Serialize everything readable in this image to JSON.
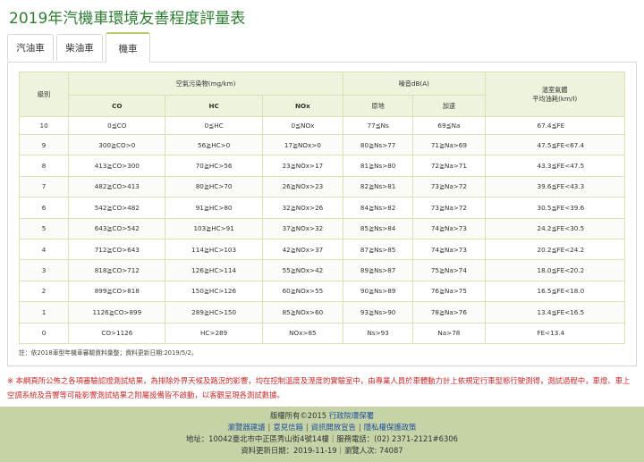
{
  "page": {
    "title": "2019年汽機車環境友善程度評量表"
  },
  "tabs": [
    "汽油車",
    "柴油車",
    "機車"
  ],
  "table": {
    "header": {
      "grade": "級別",
      "air": "空氣污染物(mg/km)",
      "noise": "噪音dB(A)",
      "fuel_line1": "溫室氣體",
      "fuel_line2": "平均油耗(km/l)",
      "co": "CO",
      "hc": "HC",
      "nox": "NOx",
      "stationary": "原地",
      "accel": "加速"
    },
    "rows": [
      [
        "10",
        "0≦CO",
        "0≦HC",
        "0≦NOx",
        "77≦Ns",
        "69≦Na",
        "67.4≦FE"
      ],
      [
        "9",
        "300≧CO>0",
        "56≧HC>0",
        "17≧NOx>0",
        "80≧Ns>77",
        "71≧Na>69",
        "47.5≦FE<67.4"
      ],
      [
        "8",
        "413≧CO>300",
        "70≧HC>56",
        "23≧NOx>17",
        "81≧Ns>80",
        "72≧Na>71",
        "43.3≦FE<47.5"
      ],
      [
        "7",
        "482≧CO>413",
        "80≧HC>70",
        "26≧NOx>23",
        "82≧Ns>81",
        "73≧Na>72",
        "39.6≦FE<43.3"
      ],
      [
        "6",
        "542≧CO>482",
        "91≧HC>80",
        "32≧NOx>26",
        "84≧Ns>82",
        "73≧Na>72",
        "30.5≦FE<39.6"
      ],
      [
        "5",
        "643≧CO>542",
        "103≧HC>91",
        "37≧NOx>32",
        "85≧Ns>84",
        "74≧Na>73",
        "24.2≦FE<30.5"
      ],
      [
        "4",
        "712≧CO>643",
        "114≧HC>103",
        "42≧NOx>37",
        "87≧Ns>85",
        "74≧Na>73",
        "20.2≦FE<24.2"
      ],
      [
        "3",
        "818≧CO>712",
        "126≧HC>114",
        "55≧NOx>42",
        "89≧Ns>87",
        "75≧Na>74",
        "18.0≦FE<20.2"
      ],
      [
        "2",
        "899≧CO>818",
        "150≧HC>126",
        "60≧NOx>55",
        "90≧Ns>89",
        "76≧Na>75",
        "16.5≦FE<18.0"
      ],
      [
        "1",
        "1126≧CO>899",
        "289≧HC>150",
        "85≧NOx>60",
        "93≧Ns>90",
        "78≧Na>76",
        "13.4≦FE<16.5"
      ],
      [
        "0",
        "CO>1126",
        "HC>289",
        "NOx>85",
        "Ns>93",
        "Na>78",
        "FE<13.4"
      ]
    ]
  },
  "footnote": "註：依2018車型年機車審驗資料彙整；資料更新日期:2019/5/2。",
  "notice": "※ 本網頁所公佈之各項審驗認證測試結果，為排除外界天候及路況的影響，均在控制溫度及溼度的實驗室中，由專業人員於車體動力計上依規定行車型態行駛測得，測試過程中，車燈、車上空調系統及音響等可能影響測試結果之附屬設備皆不啟動，以客觀呈現各測試數據。",
  "footer": {
    "copyright": "版權所有©2015",
    "org_link": "行政院環保署",
    "links": [
      "瀏覽器建議",
      "意見信箱",
      "資訊開放宣告",
      "隱私權保護政策"
    ],
    "address": "地址：10042臺北市中正區秀山街4號14樓｜服務電話：(02) 2371-2121#6306",
    "update": "資料更新日期：2019-11-19｜瀏覽人次: 74087"
  }
}
